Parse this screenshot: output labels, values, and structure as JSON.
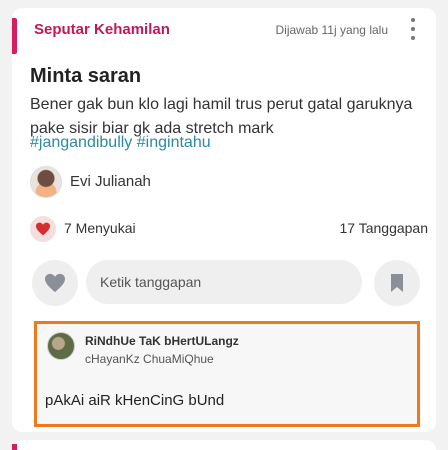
{
  "post": {
    "category": "Seputar Kehamilan",
    "answered": "Dijawab 11j yang lalu",
    "title": "Minta saran",
    "body": "Bener gak bun klo lagi hamil trus perut gatal garuknya pake sisir biar gk ada stretch mark",
    "hashtags": [
      "#jangandibully",
      "#ingintahu"
    ],
    "author": "Evi Julianah",
    "likes": "7 Menyukai",
    "responses": "17 Tanggapan"
  },
  "reply_bar": {
    "placeholder": "Ketik tanggapan"
  },
  "top_reply": {
    "name": "RiNdhUe TaK bHertULangz",
    "subtitle": "cHayanKz ChuaMiQhue",
    "text": "pAkAi aiR kHenCinG bUnd"
  },
  "colors": {
    "accent": "#c2185b",
    "hashtag": "#2c8aa3",
    "highlight_border": "#f0781e"
  },
  "icons": [
    "kebab-menu-icon",
    "heart-icon",
    "bookmark-icon"
  ]
}
